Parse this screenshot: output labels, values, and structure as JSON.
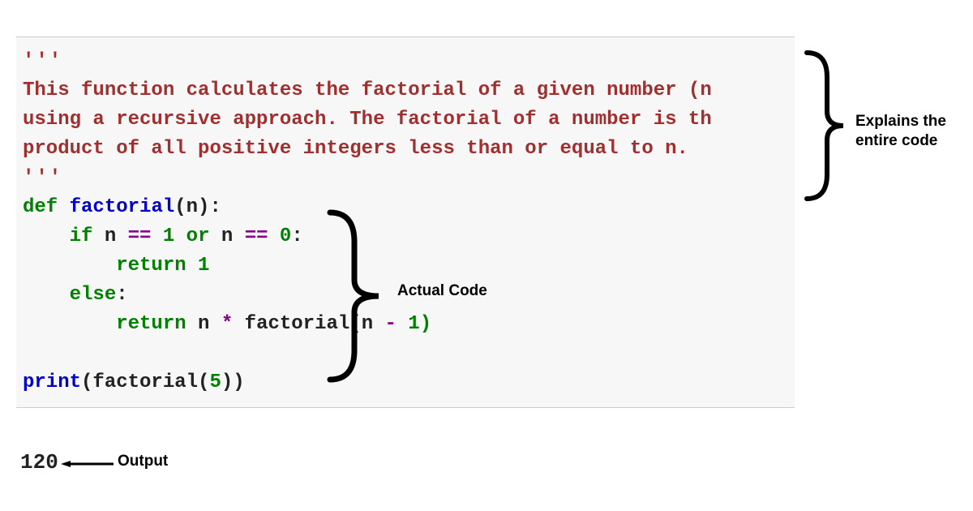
{
  "code": {
    "triple_quote": "'''",
    "docstring_line1": "This function calculates the factorial of a given number (n",
    "docstring_line2": "using a recursive approach. The factorial of a number is th",
    "docstring_line3": "product of all positive integers less than or equal to n.",
    "def_kw": "def",
    "fn_name": "factorial",
    "paren_n": "(n):",
    "if_kw": "if",
    "if_cond_n": " n ",
    "eq_op": "==",
    "one": " 1 ",
    "or_kw": "or",
    "n_sp": " n ",
    "zero": " 0",
    "colon": ":",
    "return_kw": "return",
    "ret1": " 1",
    "else_kw": "else",
    "ret_n": " n ",
    "star": "*",
    "fac_call": " factorial(n ",
    "minus": "-",
    "one_paren": " 1)",
    "print_call": "print",
    "print_arg": "(factorial(",
    "five": "5",
    "close": "))"
  },
  "output_value": "120",
  "annotations": {
    "explains": "Explains the entire code",
    "actual": "Actual Code",
    "output": "Output"
  }
}
